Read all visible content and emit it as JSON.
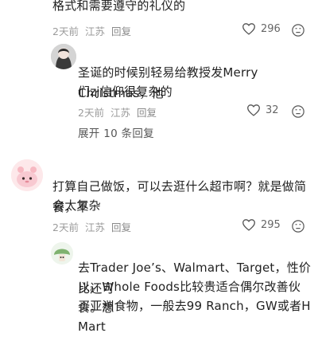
{
  "comments": [
    {
      "text_tail": "格式和需要遵守的礼仪的",
      "time": "2天前",
      "location": "江苏",
      "reply_label": "回复",
      "likes": "296"
    },
    {
      "text": "圣诞的时候别轻易给教授发Merry Christmas，他们zj信仰很复杂的",
      "text_line1": "圣诞的时候别轻易给教授发Merry Christmas，他",
      "text_line2": "们zj信仰很复杂的",
      "time": "2天前",
      "location": "江苏",
      "reply_label": "回复",
      "likes": "32",
      "expand_label": "展开 10 条回复"
    },
    {
      "text": "打算自己做饭，可以去逛什么超市啊？就是做简餐，不会太复杂",
      "text_line1": "打算自己做饭，可以去逛什么超市啊？就是做简餐，不",
      "text_line2": "会太复杂",
      "time": "2天前",
      "location": "江苏",
      "reply_label": "回复",
      "likes": "295"
    },
    {
      "text_line1": "去Trader Joe’s、Walmart、Target，性价比还可",
      "text_line2": "以。Whole Foods比较贵适合偶尔改善伙食。想",
      "text_line3": "买亚洲食物，一般去99 Ranch，GW或者H Mart"
    }
  ],
  "icons": {
    "heart": "heart-icon",
    "dislike": "dislike-face-icon",
    "avatar_placeholder": "avatar"
  },
  "colors": {
    "meta_gray": "#9b9b9b",
    "text": "#222222",
    "likes_gray": "#666666"
  }
}
